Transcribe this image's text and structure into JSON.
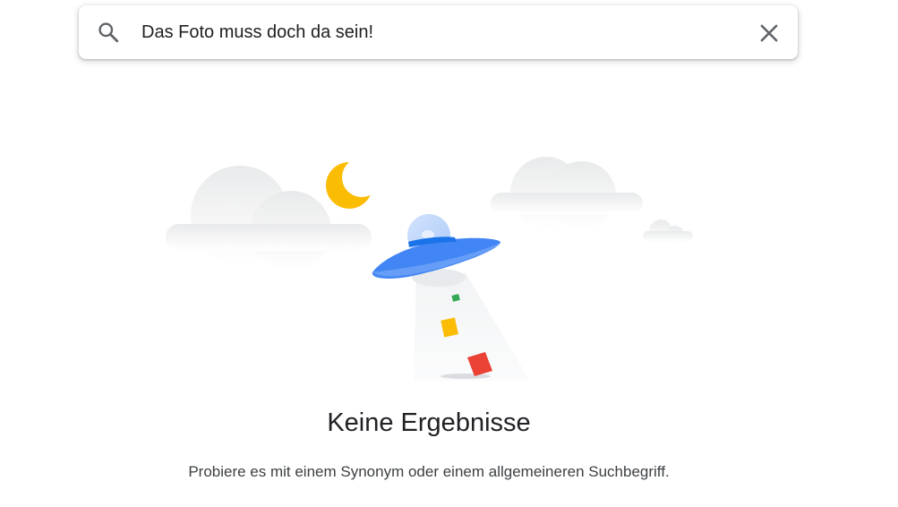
{
  "search": {
    "query": "Das Foto muss doch da sein!",
    "search_icon": "search-icon",
    "clear_icon": "close-icon"
  },
  "empty_state": {
    "illustration": "ufo-illustration",
    "title": "Keine Ergebnisse",
    "hint": "Probiere es mit einem Synonym oder einem allgemeineren Suchbegriff."
  },
  "colors": {
    "ufo_blue": "#4285f4",
    "moon_yellow": "#fbbc04",
    "green": "#34a853",
    "red": "#ea4335",
    "text": "#202124"
  }
}
